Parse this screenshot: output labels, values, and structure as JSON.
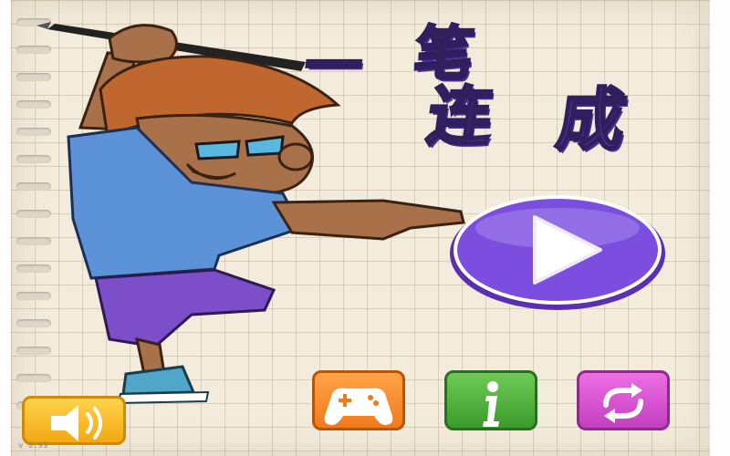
{
  "title": {
    "char1": "一",
    "char2": "笔",
    "char3": "连",
    "char4": "成"
  },
  "version": "v 0.99",
  "buttons": {
    "play": "play-icon",
    "sound": "speaker-icon",
    "games": "gamepad-icon",
    "info": "info-icon",
    "swap": "swap-icon"
  },
  "colors": {
    "title_purple": "#7a4fd6",
    "play_button": "#7c4ee0",
    "sound_button": "#f6b823",
    "gamepad_button": "#f58a2a",
    "info_button": "#4fb03c",
    "swap_button": "#d653d4",
    "paper": "#f3ecdc"
  }
}
